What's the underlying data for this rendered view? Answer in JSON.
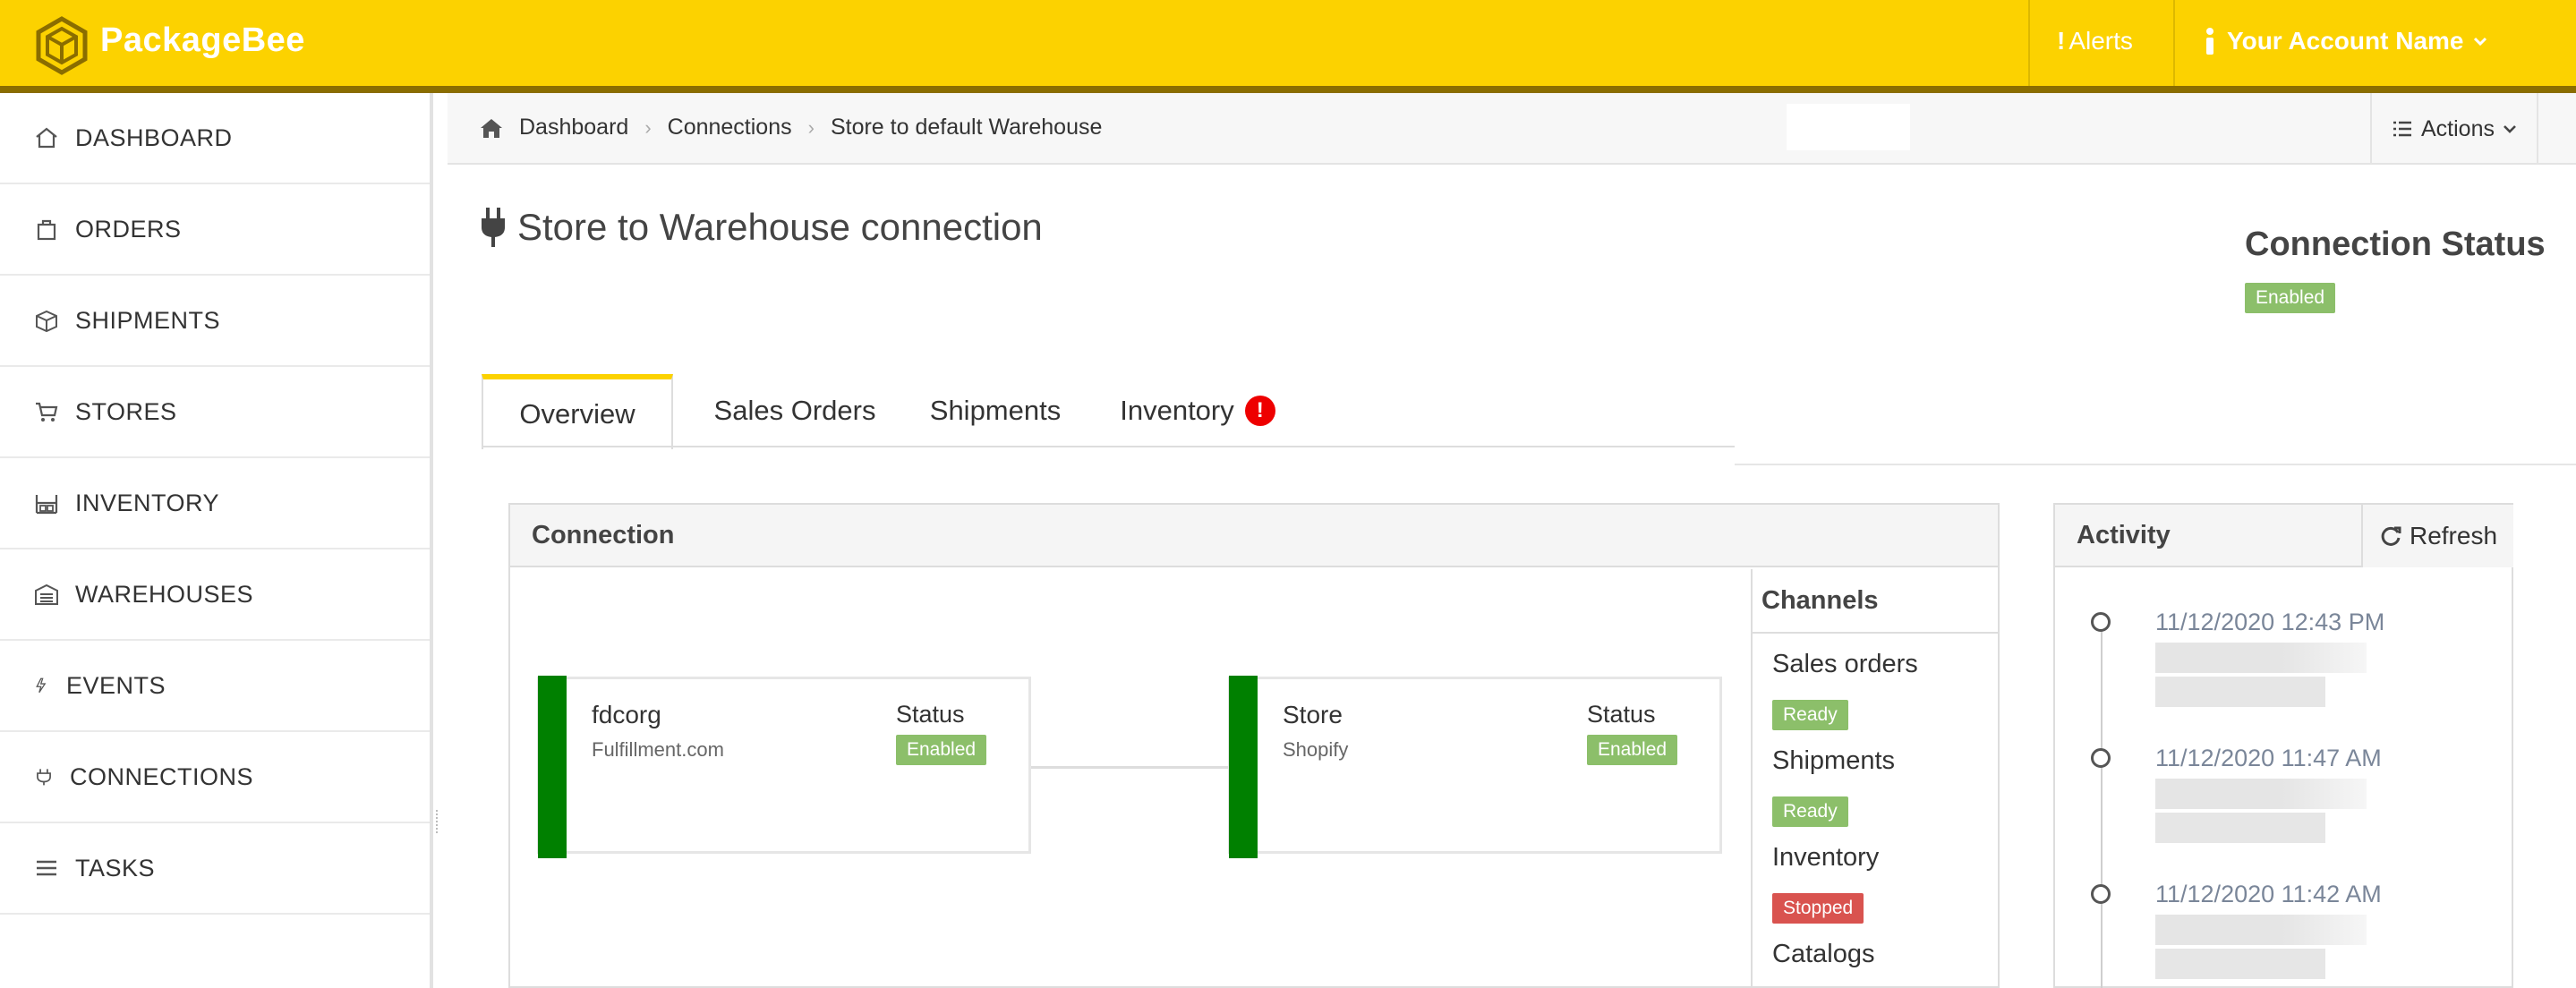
{
  "app": {
    "brand": "PackageBee",
    "accent": "#fcd200"
  },
  "topbar": {
    "alerts_label": "Alerts",
    "account_label": "Your Account Name"
  },
  "sidebar": {
    "items": [
      {
        "label": "DASHBOARD",
        "icon": "home-icon"
      },
      {
        "label": "ORDERS",
        "icon": "bag-icon"
      },
      {
        "label": "SHIPMENTS",
        "icon": "box-icon"
      },
      {
        "label": "STORES",
        "icon": "cart-icon"
      },
      {
        "label": "INVENTORY",
        "icon": "warehouse-shelf-icon"
      },
      {
        "label": "WAREHOUSES",
        "icon": "warehouse-icon"
      },
      {
        "label": "EVENTS",
        "icon": "bolt-icon"
      },
      {
        "label": "CONNECTIONS",
        "icon": "plug-icon"
      },
      {
        "label": "TASKS",
        "icon": "list-icon"
      }
    ]
  },
  "breadcrumb": {
    "items": [
      "Dashboard",
      "Connections",
      "Store to default Warehouse"
    ]
  },
  "actions_label": "Actions",
  "page": {
    "title": "Store to Warehouse connection"
  },
  "connection_status": {
    "title": "Connection Status",
    "value": "Enabled"
  },
  "tabs": [
    {
      "label": "Overview",
      "active": true
    },
    {
      "label": "Sales Orders"
    },
    {
      "label": "Shipments"
    },
    {
      "label": "Inventory",
      "alert": "!"
    }
  ],
  "connection_panel": {
    "title": "Connection",
    "left_node": {
      "name": "fdcorg",
      "sub": "Fulfillment.com",
      "status_label": "Status",
      "status": "Enabled"
    },
    "right_node": {
      "name": "Store",
      "sub": "Shopify",
      "status_label": "Status",
      "status": "Enabled"
    },
    "channels": {
      "title": "Channels",
      "items": [
        {
          "name": "Sales orders",
          "status": "Ready"
        },
        {
          "name": "Shipments",
          "status": "Ready"
        },
        {
          "name": "Inventory",
          "status": "Stopped"
        },
        {
          "name": "Catalogs",
          "status": ""
        }
      ]
    }
  },
  "activity": {
    "title": "Activity",
    "refresh_label": "Refresh",
    "entries": [
      {
        "date": "11/12/2020 12:43 PM"
      },
      {
        "date": "11/12/2020 11:47 AM"
      },
      {
        "date": "11/12/2020 11:42 AM"
      }
    ]
  }
}
